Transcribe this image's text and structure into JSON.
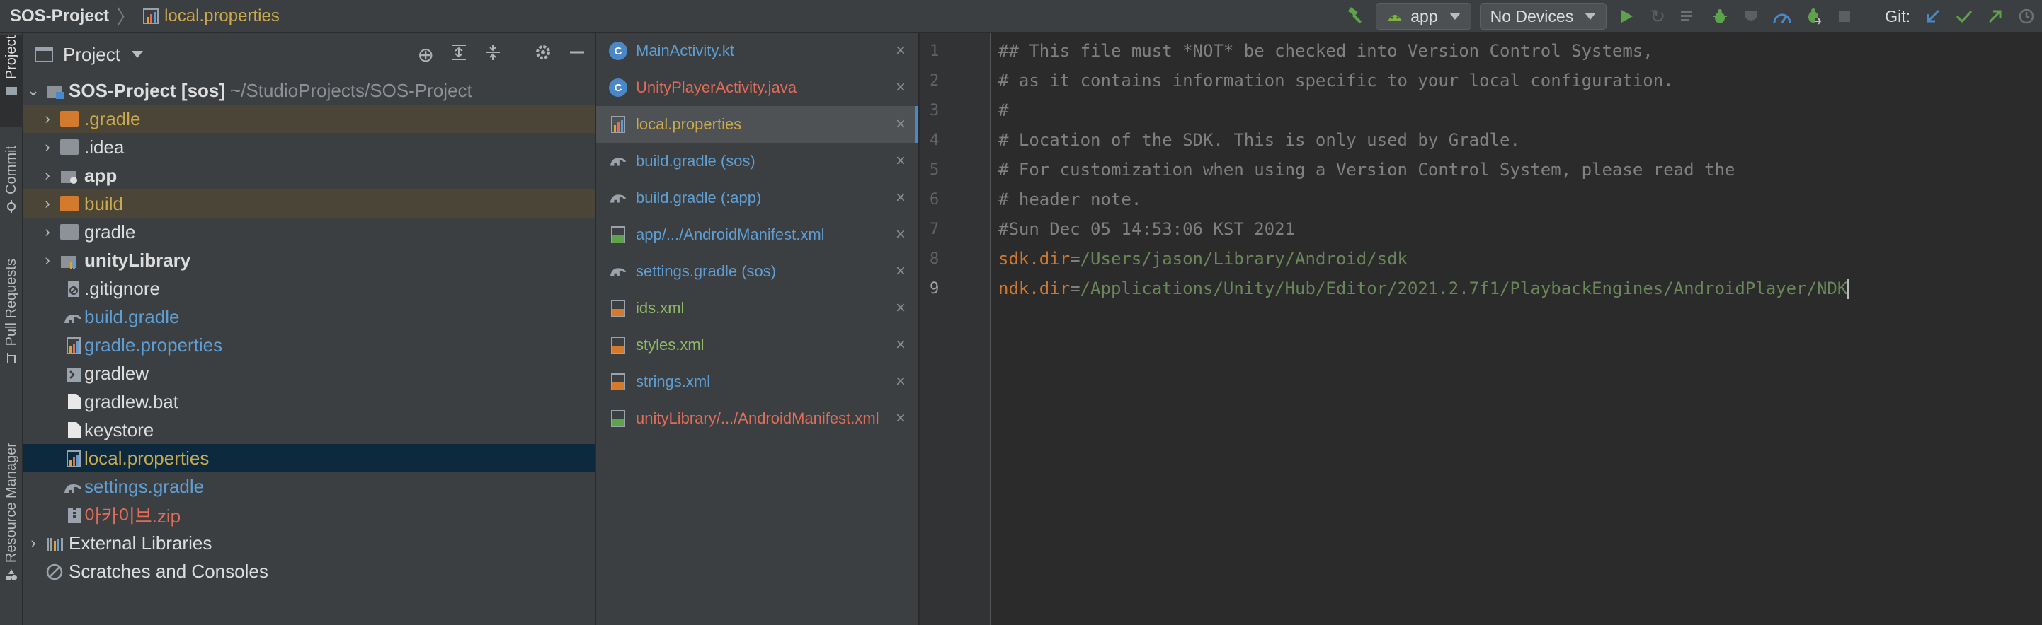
{
  "breadcrumb": {
    "project": "SOS-Project",
    "file": "local.properties"
  },
  "toolbar": {
    "run_config": "app",
    "device": "No Devices",
    "git_label": "Git:"
  },
  "side_tabs": [
    "Project",
    "Commit",
    "Pull Requests",
    "Resource Manager"
  ],
  "project_panel": {
    "title": "Project",
    "root": {
      "name": "SOS-Project [sos]",
      "path": "~/StudioProjects/SOS-Project"
    },
    "items": [
      {
        "name": ".gradle",
        "kind": "folder-orange"
      },
      {
        "name": ".idea",
        "kind": "folder"
      },
      {
        "name": "app",
        "kind": "module"
      },
      {
        "name": "build",
        "kind": "folder-orange"
      },
      {
        "name": "gradle",
        "kind": "folder"
      },
      {
        "name": "unityLibrary",
        "kind": "module"
      },
      {
        "name": ".gitignore",
        "kind": "file"
      },
      {
        "name": "build.gradle",
        "kind": "gradle"
      },
      {
        "name": "gradle.properties",
        "kind": "properties"
      },
      {
        "name": "gradlew",
        "kind": "shell"
      },
      {
        "name": "gradlew.bat",
        "kind": "file"
      },
      {
        "name": "keystore",
        "kind": "file"
      },
      {
        "name": "local.properties",
        "kind": "properties"
      },
      {
        "name": "settings.gradle",
        "kind": "gradle"
      },
      {
        "name": "아카이브.zip",
        "kind": "zip"
      }
    ],
    "external": "External Libraries",
    "scratches": "Scratches and Consoles"
  },
  "open_tabs": [
    {
      "label": "MainActivity.kt",
      "kind": "kotlin"
    },
    {
      "label": "UnityPlayerActivity.java",
      "kind": "java"
    },
    {
      "label": "local.properties",
      "kind": "properties"
    },
    {
      "label": "build.gradle (sos)",
      "kind": "gradle"
    },
    {
      "label": "build.gradle (:app)",
      "kind": "gradle"
    },
    {
      "label": "app/.../AndroidManifest.xml",
      "kind": "manifest"
    },
    {
      "label": "settings.gradle (sos)",
      "kind": "gradle"
    },
    {
      "label": "ids.xml",
      "kind": "xml"
    },
    {
      "label": "styles.xml",
      "kind": "xml"
    },
    {
      "label": "strings.xml",
      "kind": "xml"
    },
    {
      "label": "unityLibrary/.../AndroidManifest.xml",
      "kind": "manifest"
    }
  ],
  "editor": {
    "line_numbers": [
      "1",
      "2",
      "3",
      "4",
      "5",
      "6",
      "7",
      "8",
      "9"
    ],
    "lines": [
      "## This file must *NOT* be checked into Version Control Systems,",
      "# as it contains information specific to your local configuration.",
      "#",
      "# Location of the SDK. This is only used by Gradle.",
      "# For customization when using a Version Control System, please read the",
      "# header note.",
      "#Sun Dec 05 14:53:06 KST 2021"
    ],
    "sdk_key": "sdk.dir",
    "sdk_eq": "=",
    "sdk_value": "/Users/jason/Library/Android/sdk",
    "ndk_key": "ndk.dir",
    "ndk_eq": "=",
    "ndk_value": "/Applications/Unity/Hub/Editor/2021.2.7f1/PlaybackEngines/AndroidPlayer/NDK"
  }
}
